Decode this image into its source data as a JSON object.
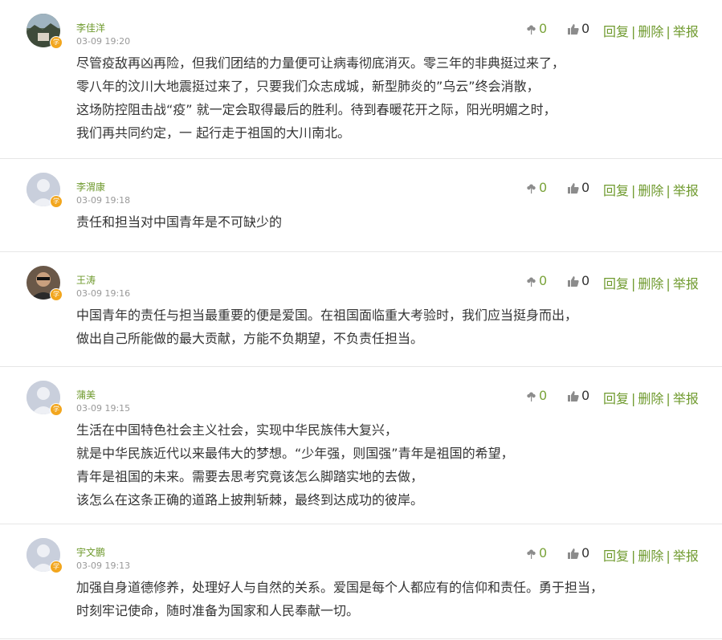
{
  "comments": [
    {
      "name": "李佳洋",
      "time": "03-09 19:20",
      "flowers": "0",
      "likes": "0",
      "avatar": "photo-landscape",
      "lines": [
        "尽管疫敌再凶再险，但我们团结的力量便可让病毒彻底消灭。零三年的非典挺过来了，",
        "零八年的汶川大地震挺过来了，只要我们众志成城，新型肺炎的”乌云”终会消散，",
        "这场防控阻击战“疫” 就一定会取得最后的胜利。待到春暖花开之际，阳光明媚之时，",
        "我们再共同约定，一 起行走于祖国的大川南北。"
      ]
    },
    {
      "name": "李渭康",
      "time": "03-09 19:18",
      "flowers": "0",
      "likes": "0",
      "avatar": "default",
      "lines": [
        "责任和担当对中国青年是不可缺少的"
      ]
    },
    {
      "name": "王涛",
      "time": "03-09 19:16",
      "flowers": "0",
      "likes": "0",
      "avatar": "photo-person",
      "lines": [
        "中国青年的责任与担当最重要的便是爱国。在祖国面临重大考验时，我们应当挺身而出，",
        "做出自己所能做的最大贡献，方能不负期望，不负责任担当。"
      ]
    },
    {
      "name": "蒲美",
      "time": "03-09 19:15",
      "flowers": "0",
      "likes": "0",
      "avatar": "default",
      "lines": [
        "生活在中国特色社会主义社会，实现中华民族伟大复兴，",
        "就是中华民族近代以来最伟大的梦想。“少年强，则国强”青年是祖国的希望，",
        "青年是祖国的未来。需要去思考究竟该怎么脚踏实地的去做，",
        "该怎么在这条正确的道路上披荆斩棘，最终到达成功的彼岸。"
      ]
    },
    {
      "name": "宇文鹏",
      "time": "03-09 19:13",
      "flowers": "0",
      "likes": "0",
      "avatar": "default",
      "lines": [
        "加强自身道德修养，处理好人与自然的关系。爱国是每个人都应有的信仰和责任。勇于担当，",
        "时刻牢记使命，随时准备为国家和人民奉献一切。"
      ]
    }
  ],
  "labels": {
    "reply": "回复",
    "delete": "删除",
    "report": "举报",
    "separator": "|",
    "badge": "学"
  },
  "icons": {
    "flower": "flower-icon",
    "like": "thumbs-up-icon"
  },
  "colors": {
    "name": "#6f9a2e",
    "badge": "#f2a61e",
    "divider": "#e6e6e6"
  }
}
